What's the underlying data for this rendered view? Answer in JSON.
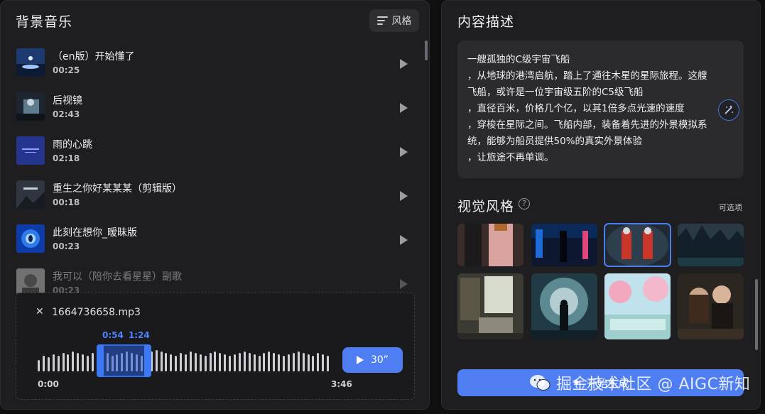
{
  "left": {
    "title": "背景音乐",
    "style_button_label": "风格",
    "music_items": [
      {
        "title": "（en版）开始懂了",
        "duration": "00:25"
      },
      {
        "title": "后视镜",
        "duration": "02:43"
      },
      {
        "title": "雨的心跳",
        "duration": "02:18"
      },
      {
        "title": "重生之你好某某某（剪辑版）",
        "duration": "00:18"
      },
      {
        "title": "此刻在想你_暧昧版",
        "duration": "00:23"
      },
      {
        "title": "我可以（陪你去看星星）副歌",
        "duration": "00:23"
      }
    ],
    "player": {
      "file_name": "1664736658.mp3",
      "selection_start": "0:54",
      "selection_end": "1:24",
      "time_start": "0:00",
      "time_end": "3:46",
      "play_button_label": "30”"
    }
  },
  "right": {
    "title": "内容描述",
    "description_lines": [
      "一艘孤独的C级宇宙飞船",
      "，从地球的港湾启航，踏上了通往木星的星际旅程。这艘",
      "飞船，或许是一位宇宙级五阶的C5级飞船",
      "，直径百米，价格几个亿，以其1倍多点光速的速度",
      "，穿梭在星际之间。飞船内部，装备着先进的外景模拟系",
      "统，能够为船员提供50%的真实外景体验",
      "，让旅途不再单调。"
    ],
    "visual_style_title": "视觉风格",
    "help_glyph": "?",
    "optional_label": "可选项",
    "generate_button_label": "开始生成"
  },
  "watermark_text": "掘金技术社区 @ AIGC新知",
  "colors": {
    "accent": "#4f7df2",
    "panel": "#1e1e20",
    "background": "#0f0f10"
  }
}
